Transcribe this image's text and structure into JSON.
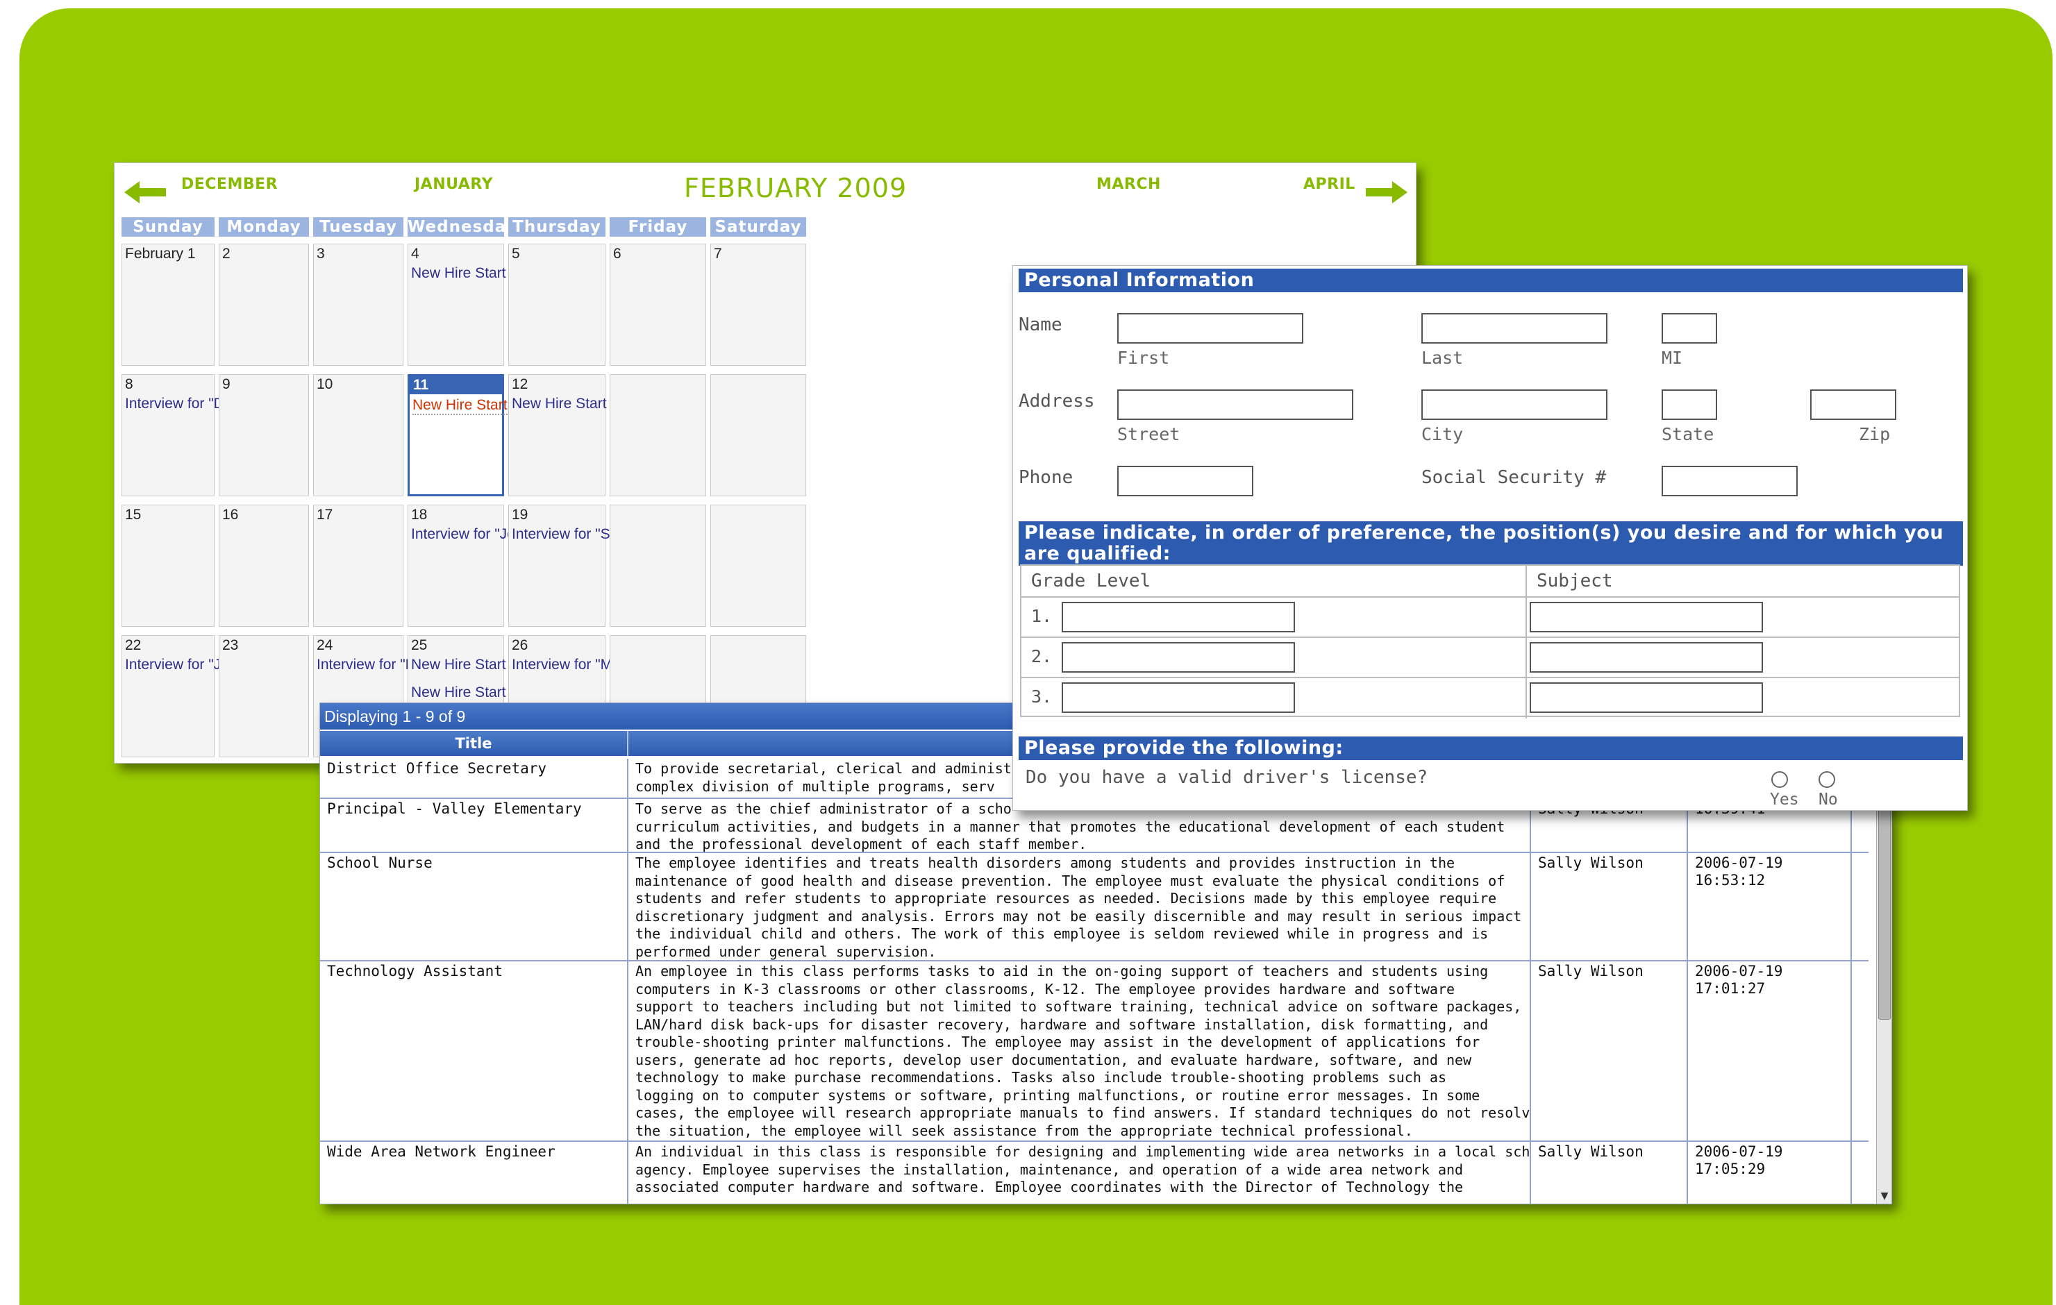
{
  "calendar": {
    "title": "FEBRUARY 2009",
    "nav": {
      "prev2": "DECEMBER",
      "prev1": "JANUARY",
      "next1": "MARCH",
      "next2": "APRIL"
    },
    "colors": {
      "accent": "#88bb00",
      "header": "#9bb4e0",
      "today": "#3764b3"
    },
    "days": [
      "Sunday",
      "Monday",
      "Tuesday",
      "Wednesday",
      "Thursday",
      "Friday",
      "Saturday"
    ],
    "weeks": [
      [
        {
          "num": "February 1",
          "events": []
        },
        {
          "num": "2",
          "events": []
        },
        {
          "num": "3",
          "events": []
        },
        {
          "num": "4",
          "events": [
            "New Hire Start Date fo..."
          ]
        },
        {
          "num": "5",
          "events": []
        },
        {
          "num": "6",
          "events": []
        },
        {
          "num": "7",
          "events": []
        }
      ],
      [
        {
          "num": "8",
          "events": [
            "Interview for \"David M..."
          ]
        },
        {
          "num": "9",
          "events": []
        },
        {
          "num": "10",
          "events": []
        },
        {
          "num": "11",
          "events": [
            "New Hire Start Date fo..."
          ],
          "today": true
        },
        {
          "num": "12",
          "events": [
            "New Hire Start Date fo"
          ]
        },
        {
          "num": "",
          "events": []
        },
        {
          "num": "",
          "events": []
        }
      ],
      [
        {
          "num": "15",
          "events": []
        },
        {
          "num": "16",
          "events": []
        },
        {
          "num": "17",
          "events": []
        },
        {
          "num": "18",
          "events": [
            "Interview for \"Jeff Tr..."
          ]
        },
        {
          "num": "19",
          "events": [
            "Interview for \"Sam Dor"
          ]
        },
        {
          "num": "",
          "events": []
        },
        {
          "num": "",
          "events": []
        }
      ],
      [
        {
          "num": "22",
          "events": [
            "Interview for \"Jen Zel..."
          ]
        },
        {
          "num": "23",
          "events": []
        },
        {
          "num": "24",
          "events": [
            "Interview for \"Bev Mil..."
          ]
        },
        {
          "num": "25",
          "events": [
            "New Hire Start Date fo...",
            "New Hire Start Date fo..."
          ]
        },
        {
          "num": "26",
          "events": [
            "Interview for \"Madison"
          ]
        },
        {
          "num": "",
          "events": []
        },
        {
          "num": "",
          "events": []
        }
      ]
    ]
  },
  "jobs": {
    "status": "Displaying 1 - 9 of 9",
    "columns": [
      "Title",
      "",
      "",
      ""
    ],
    "rows": [
      {
        "title": "District Office Secretary",
        "desc": "To provide secretarial, clerical and administ\ncomplex division of multiple programs, serv",
        "author": "",
        "date": ""
      },
      {
        "title": "Principal - Valley Elementary",
        "desc": "To serve as the chief administrator of a scho\ncurriculum activities, and budgets in a manner that promotes the educational development of each student\nand the professional development of each staff member.",
        "author": "Sally Wilson",
        "date": "16:39:41"
      },
      {
        "title": "School Nurse",
        "desc": "The employee identifies and treats health disorders among students and provides instruction in the\nmaintenance of good health and disease prevention. The employee must evaluate the physical conditions of\nstudents and refer students to appropriate resources as needed. Decisions made by this employee require\ndiscretionary judgment and analysis. Errors may not be easily discernible and may result in serious impact on\nthe individual child and others. The work of this employee is seldom reviewed while in progress and is\nperformed under general supervision.",
        "author": "Sally Wilson",
        "date": "2006-07-19\n16:53:12"
      },
      {
        "title": "Technology Assistant",
        "desc": "An employee in this class performs tasks to aid in the on-going support of teachers and students using\ncomputers in K-3 classrooms or other classrooms, K-12. The employee provides hardware and software\nsupport to teachers including but not limited to software training, technical advice on software packages,\nLAN/hard disk back-ups for disaster recovery, hardware and software installation, disk formatting, and\ntrouble-shooting printer malfunctions. The employee may assist in the development of applications for\nusers, generate ad hoc reports, develop user documentation, and evaluate hardware, software, and new\ntechnology to make purchase recommendations. Tasks also include trouble-shooting problems such as\nlogging on to computer systems or software, printing malfunctions, or routine error messages. In some\ncases, the employee will research appropriate manuals to find answers. If standard techniques do not resolve\nthe situation, the employee will seek assistance from the appropriate technical professional.",
        "author": "Sally Wilson",
        "date": "2006-07-19\n17:01:27"
      },
      {
        "title": "Wide Area Network Engineer",
        "desc": "An individual in this class is responsible for designing and implementing wide area networks in a local school\nagency. Employee supervises the installation, maintenance, and operation of a wide area network and\nassociated computer hardware and software. Employee coordinates with the Director of Technology the",
        "author": "Sally Wilson",
        "date": "2006-07-19\n17:05:29"
      }
    ]
  },
  "form": {
    "section_personal": "Personal Information",
    "name_label": "Name",
    "first": "First",
    "last": "Last",
    "mi": "MI",
    "address_label": "Address",
    "street": "Street",
    "city": "City",
    "state": "State",
    "zip": "Zip",
    "phone_label": "Phone",
    "ssn_label": "Social Security #",
    "section_positions": "Please indicate, in order of preference, the position(s) you desire and for which you are qualified:",
    "grade_level": "Grade Level",
    "subject": "Subject",
    "rows": [
      "1.",
      "2.",
      "3."
    ],
    "section_following": "Please provide the following:",
    "license_q": "Do you have a valid driver's license?",
    "yes": "Yes",
    "no": "No"
  }
}
